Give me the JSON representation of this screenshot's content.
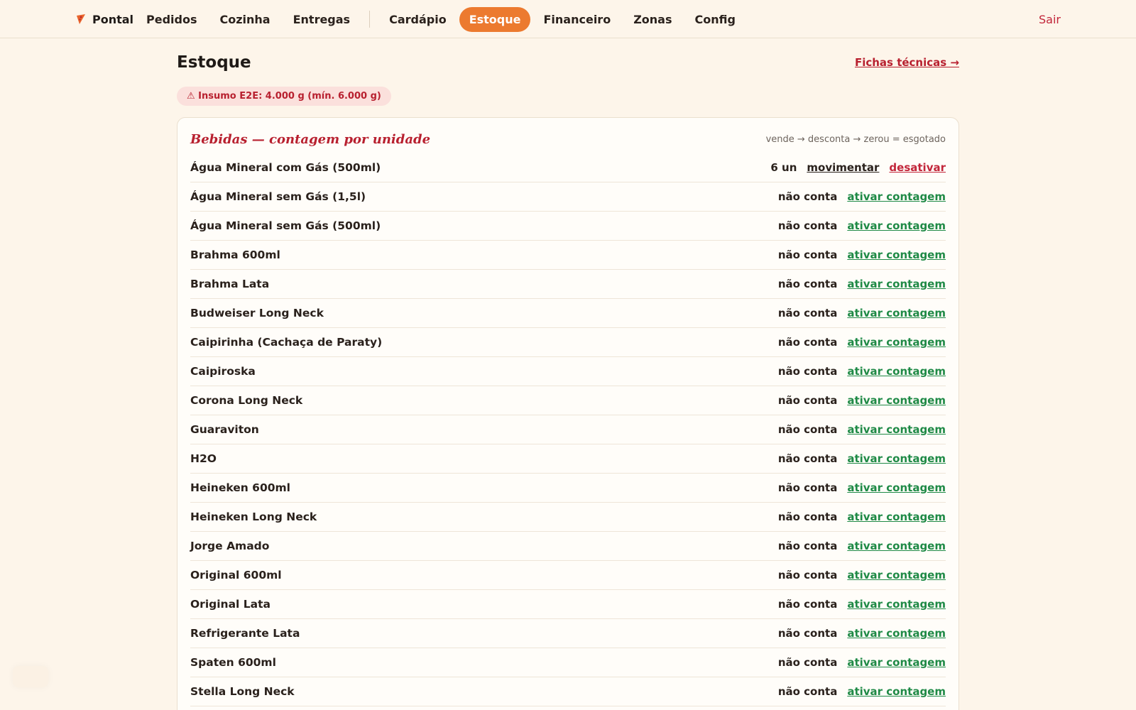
{
  "header": {
    "brand": "Pontal",
    "nav": [
      "Pedidos",
      "Cozinha",
      "Entregas",
      "Cardápio",
      "Estoque",
      "Financeiro",
      "Zonas",
      "Config"
    ],
    "active": "Estoque",
    "logout": "Sair"
  },
  "page": {
    "title": "Estoque",
    "fichas_link": "Fichas técnicas →",
    "alert": "⚠ Insumo E2E: 4.000 g (mín. 6.000 g)"
  },
  "card": {
    "title": "Bebidas — contagem por unidade",
    "hint": "vende → desconta → zerou = esgotado",
    "first_row": {
      "name": "Água Mineral com Gás (500ml)",
      "qty": "6 un",
      "move": "movimentar",
      "deactivate": "desativar"
    },
    "status_label": "não conta",
    "activate_label": "ativar contagem",
    "rows": [
      "Água Mineral sem Gás (1,5l)",
      "Água Mineral sem Gás (500ml)",
      "Brahma 600ml",
      "Brahma Lata",
      "Budweiser Long Neck",
      "Caipirinha (Cachaça de Paraty)",
      "Caipiroska",
      "Corona Long Neck",
      "Guaraviton",
      "H2O",
      "Heineken 600ml",
      "Heineken Long Neck",
      "Jorge Amado",
      "Original 600ml",
      "Original Lata",
      "Refrigerante Lata",
      "Spaten 600ml",
      "Stella Long Neck"
    ]
  }
}
